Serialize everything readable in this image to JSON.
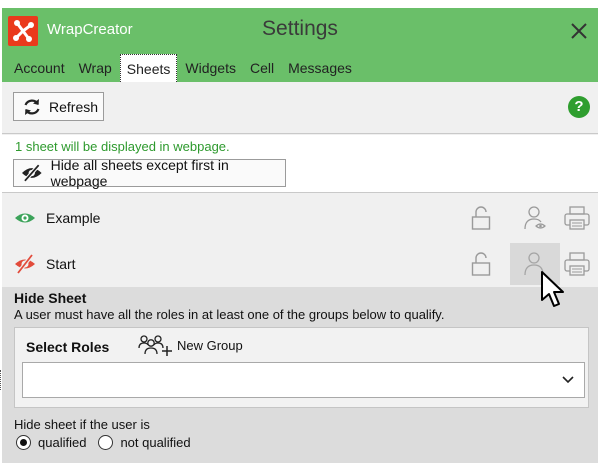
{
  "app": {
    "name": "WrapCreator",
    "window_title": "Settings",
    "icons": {
      "logo": "wrapcreator-logo",
      "close": "close-icon"
    },
    "brand_color": "#6abf69",
    "logo_color": "#ea3a1c"
  },
  "tabs": [
    {
      "label": "Account",
      "active": false
    },
    {
      "label": "Wrap",
      "active": false
    },
    {
      "label": "Sheets",
      "active": true
    },
    {
      "label": "Widgets",
      "active": false
    },
    {
      "label": "Cell",
      "active": false
    },
    {
      "label": "Messages",
      "active": false
    }
  ],
  "toolbar": {
    "refresh_label": "Refresh",
    "refresh_icon": "refresh-icon",
    "help_label": "?",
    "help_icon": "help-icon"
  },
  "info": {
    "message": "1 sheet will be displayed in webpage.",
    "hide_all_label": "Hide all sheets except first in webpage",
    "hide_all_icon": "eye-slash-icon"
  },
  "sheets": [
    {
      "name": "Example",
      "visible": true,
      "visibility_icon": "eye-icon"
    },
    {
      "name": "Start",
      "visible": false,
      "visibility_icon": "eye-slash-icon"
    }
  ],
  "hide_panel": {
    "title": "Hide Sheet",
    "description": "A user must have all the roles in at least one of the groups below to qualify.",
    "roles_label": "Select Roles",
    "new_group_label": "New Group",
    "select_value": "",
    "condition_label": "Hide sheet if the user is",
    "options": [
      {
        "label": "qualified",
        "selected": true
      },
      {
        "label": "not qualified",
        "selected": false
      }
    ]
  }
}
